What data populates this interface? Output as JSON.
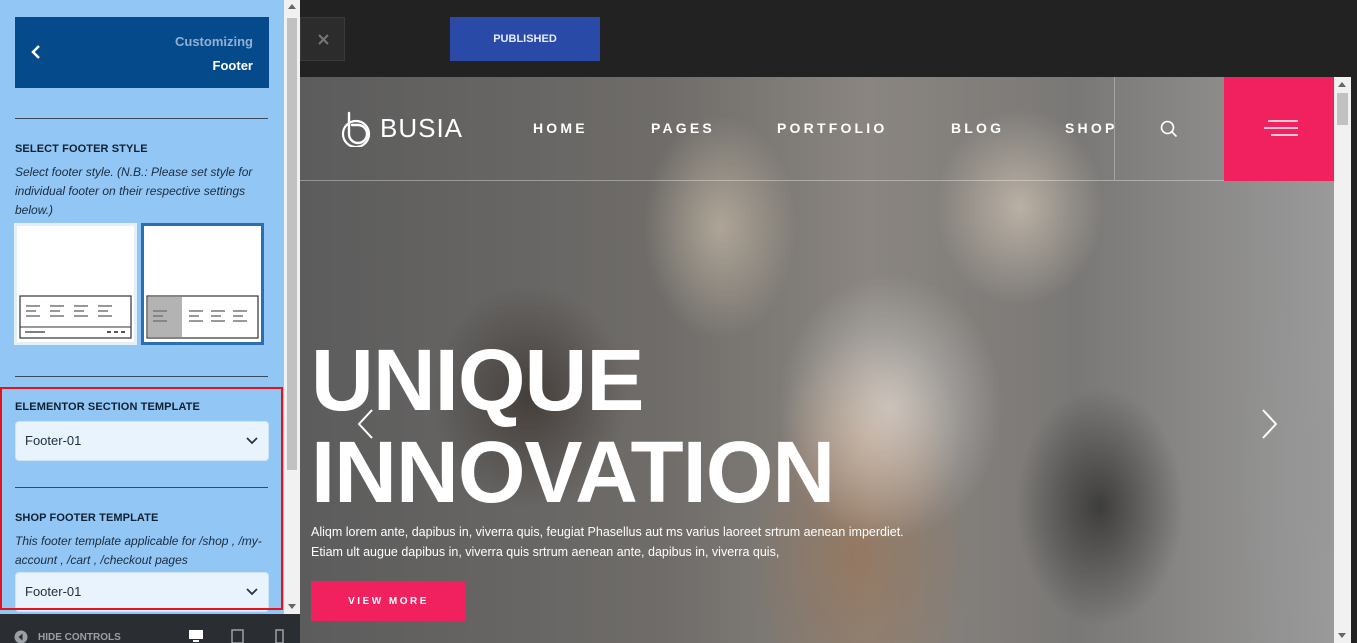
{
  "sidebar": {
    "header": {
      "crumb": "Customizing",
      "title": "Footer"
    },
    "footer_style": {
      "title": "SELECT FOOTER STYLE",
      "description": "Select footer style. (N.B.: Please set style for individual footer on their respective settings below.)",
      "options": [
        "footer-style-1",
        "footer-style-2"
      ],
      "selected_index": 1
    },
    "elementor_template": {
      "title": "ELEMENTOR SECTION TEMPLATE",
      "value": "Footer-01"
    },
    "shop_template": {
      "title": "SHOP FOOTER TEMPLATE",
      "description": "This footer template applicable for /shop , /my-account , /cart , /checkout pages",
      "value": "Footer-01"
    },
    "bottom": {
      "hide_controls": "HIDE CONTROLS",
      "devices": [
        "desktop",
        "tablet",
        "mobile"
      ],
      "active_device": "desktop"
    }
  },
  "topbar": {
    "publish_label": "PUBLISHED"
  },
  "preview": {
    "logo_text": "BUSIA",
    "nav": [
      "HOME",
      "PAGES",
      "PORTFOLIO",
      "BLOG",
      "SHOP"
    ],
    "hero_title_1": "UNIQUE",
    "hero_title_2": "INNOVATION",
    "hero_desc_1": "Aliqm lorem ante, dapibus in, viverra quis, feugiat Phasellus aut ms varius laoreet srtrum aenean imperdiet.",
    "hero_desc_2": "Etiam ult augue dapibus in, viverra quis srtrum aenean ante, dapibus in, viverra quis,",
    "cta": "VIEW MORE"
  },
  "colors": {
    "sidebar_bg": "#91c6f5",
    "header_bg": "#054a8a",
    "accent": "#f0215e",
    "publish": "#2a4aa8",
    "highlight": "#e3141e"
  }
}
